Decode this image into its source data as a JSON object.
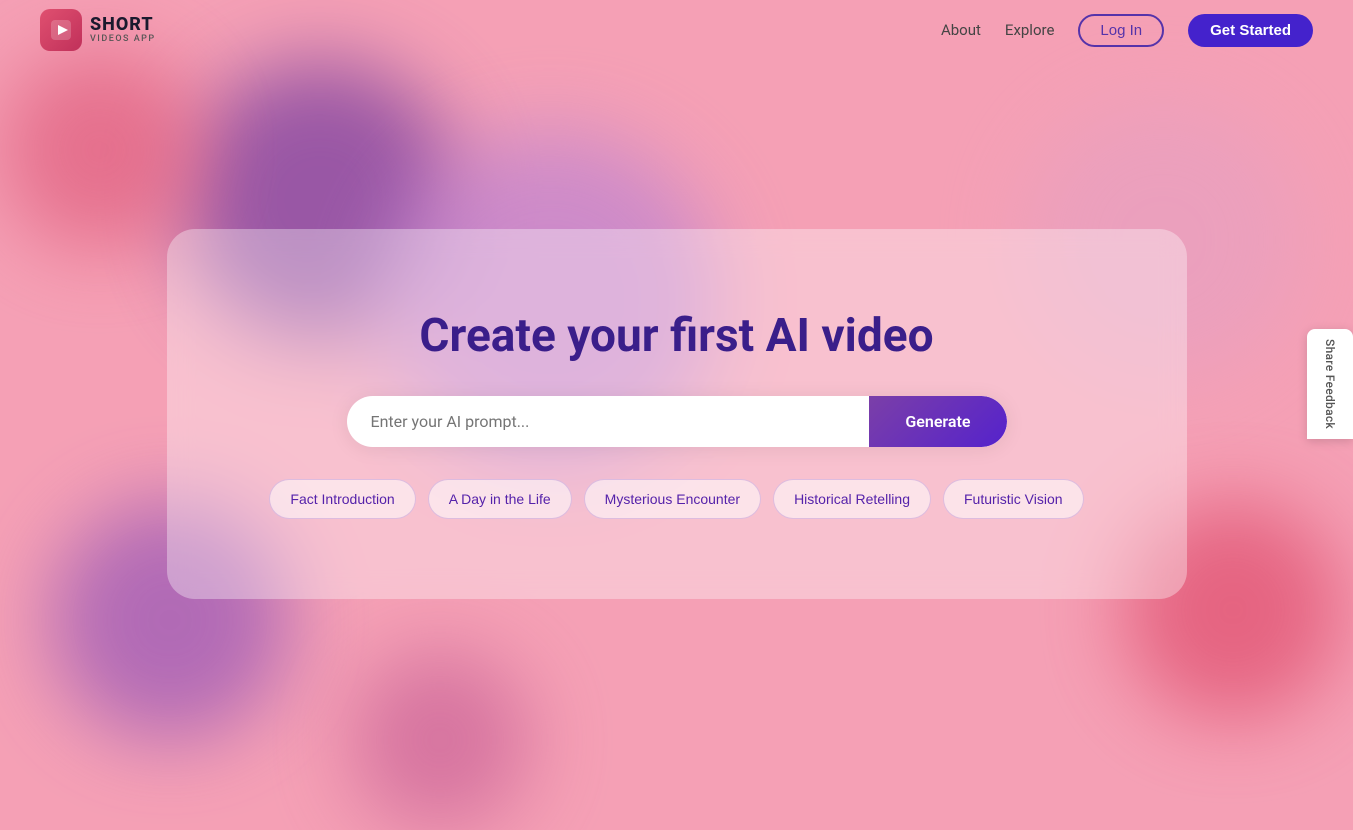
{
  "navbar": {
    "logo_main": "SHORT",
    "logo_sub": "VIDEOS APP",
    "links": [
      {
        "label": "About",
        "id": "about"
      },
      {
        "label": "Explore",
        "id": "explore"
      }
    ],
    "login_label": "Log In",
    "cta_label": "Get Started"
  },
  "main": {
    "headline": "Create your first AI video",
    "input_placeholder": "Enter your AI prompt...",
    "generate_label": "Generate",
    "chips": [
      {
        "label": "Fact Introduction",
        "id": "fact-intro"
      },
      {
        "label": "A Day in the Life",
        "id": "day-in-life"
      },
      {
        "label": "Mysterious Encounter",
        "id": "mysterious-encounter"
      },
      {
        "label": "Historical Retelling",
        "id": "historical-retelling"
      },
      {
        "label": "Futuristic Vision",
        "id": "futuristic-vision"
      }
    ]
  },
  "feedback": {
    "label": "Share Feedback"
  }
}
